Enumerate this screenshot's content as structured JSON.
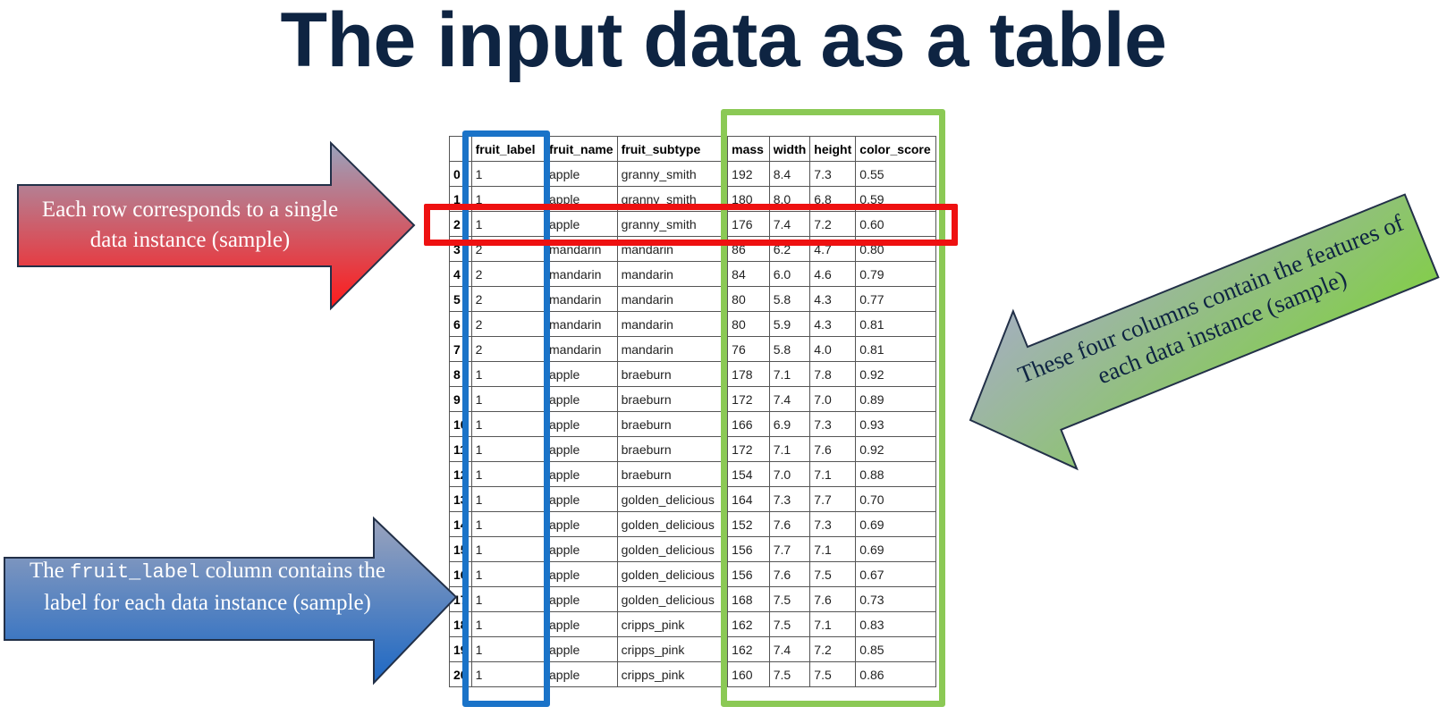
{
  "title": "The input data as a table",
  "table": {
    "columns": [
      "",
      "fruit_label",
      "fruit_name",
      "fruit_subtype",
      "mass",
      "width",
      "height",
      "color_score"
    ],
    "rows": [
      [
        "0",
        "1",
        "apple",
        "granny_smith",
        "192",
        "8.4",
        "7.3",
        "0.55"
      ],
      [
        "1",
        "1",
        "apple",
        "granny_smith",
        "180",
        "8.0",
        "6.8",
        "0.59"
      ],
      [
        "2",
        "1",
        "apple",
        "granny_smith",
        "176",
        "7.4",
        "7.2",
        "0.60"
      ],
      [
        "3",
        "2",
        "mandarin",
        "mandarin",
        "86",
        "6.2",
        "4.7",
        "0.80"
      ],
      [
        "4",
        "2",
        "mandarin",
        "mandarin",
        "84",
        "6.0",
        "4.6",
        "0.79"
      ],
      [
        "5",
        "2",
        "mandarin",
        "mandarin",
        "80",
        "5.8",
        "4.3",
        "0.77"
      ],
      [
        "6",
        "2",
        "mandarin",
        "mandarin",
        "80",
        "5.9",
        "4.3",
        "0.81"
      ],
      [
        "7",
        "2",
        "mandarin",
        "mandarin",
        "76",
        "5.8",
        "4.0",
        "0.81"
      ],
      [
        "8",
        "1",
        "apple",
        "braeburn",
        "178",
        "7.1",
        "7.8",
        "0.92"
      ],
      [
        "9",
        "1",
        "apple",
        "braeburn",
        "172",
        "7.4",
        "7.0",
        "0.89"
      ],
      [
        "10",
        "1",
        "apple",
        "braeburn",
        "166",
        "6.9",
        "7.3",
        "0.93"
      ],
      [
        "11",
        "1",
        "apple",
        "braeburn",
        "172",
        "7.1",
        "7.6",
        "0.92"
      ],
      [
        "12",
        "1",
        "apple",
        "braeburn",
        "154",
        "7.0",
        "7.1",
        "0.88"
      ],
      [
        "13",
        "1",
        "apple",
        "golden_delicious",
        "164",
        "7.3",
        "7.7",
        "0.70"
      ],
      [
        "14",
        "1",
        "apple",
        "golden_delicious",
        "152",
        "7.6",
        "7.3",
        "0.69"
      ],
      [
        "15",
        "1",
        "apple",
        "golden_delicious",
        "156",
        "7.7",
        "7.1",
        "0.69"
      ],
      [
        "16",
        "1",
        "apple",
        "golden_delicious",
        "156",
        "7.6",
        "7.5",
        "0.67"
      ],
      [
        "17",
        "1",
        "apple",
        "golden_delicious",
        "168",
        "7.5",
        "7.6",
        "0.73"
      ],
      [
        "18",
        "1",
        "apple",
        "cripps_pink",
        "162",
        "7.5",
        "7.1",
        "0.83"
      ],
      [
        "19",
        "1",
        "apple",
        "cripps_pink",
        "162",
        "7.4",
        "7.2",
        "0.85"
      ],
      [
        "20",
        "1",
        "apple",
        "cripps_pink",
        "160",
        "7.5",
        "7.5",
        "0.86"
      ]
    ]
  },
  "callouts": {
    "row": {
      "text": "Each row corresponds to a single data instance (sample)"
    },
    "label": {
      "prefix": "The",
      "code": "fruit_label",
      "suffix": "column contains the label for each data instance (sample)"
    },
    "features": {
      "text": "These four columns contain the features of each data instance (sample)"
    }
  },
  "colors": {
    "title": "#0e2442",
    "row_highlight": "#ee1111",
    "label_highlight": "#1a73c8",
    "features_highlight": "#8bc955",
    "red_arrow_top": "#9aa3bd",
    "red_arrow_bottom": "#ff1a1a",
    "blue_arrow_top": "#9aa3bd",
    "blue_arrow_bottom": "#1d68c4",
    "green_arrow_top": "#9aa3bd",
    "green_arrow_bottom": "#7fd13c"
  }
}
